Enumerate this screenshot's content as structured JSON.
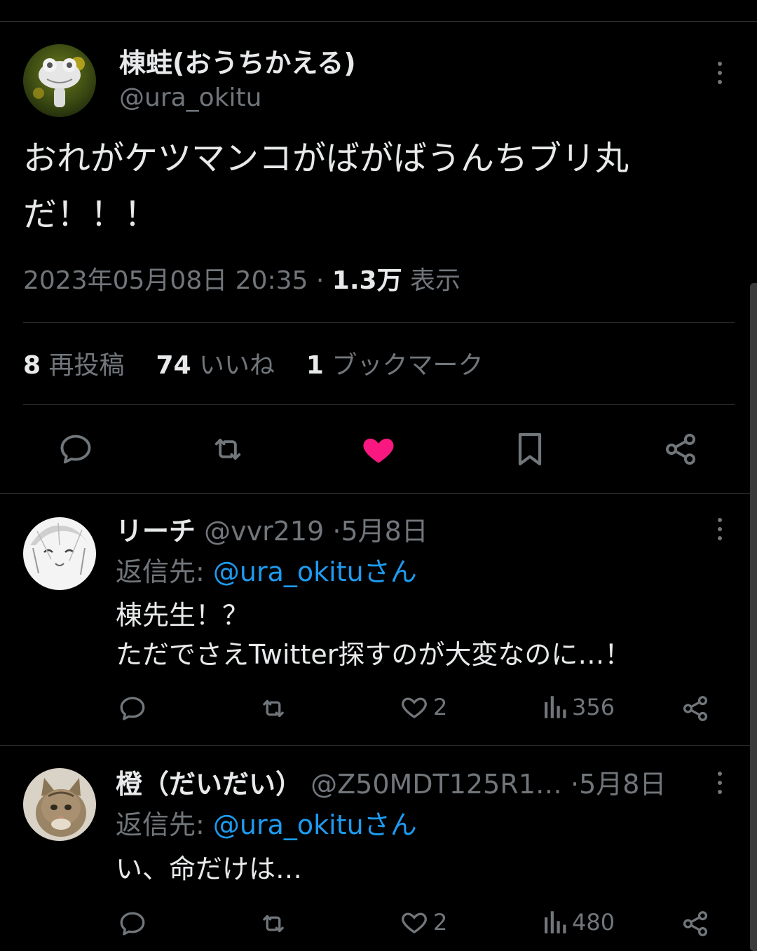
{
  "main_tweet": {
    "display_name": "棟蛙(おうちかえる)",
    "handle": "@ura_okitu",
    "text_line1": "おれがケツマンコがばがばうんちブリ丸",
    "text_line2": "だ！！！",
    "timestamp": "2023年05月08日 20:35",
    "dot": "·",
    "views_count": "1.3万",
    "views_label": "表示",
    "reposts_count": "8",
    "reposts_label": "再投稿",
    "likes_count": "74",
    "likes_label": "いいね",
    "bookmarks_count": "1",
    "bookmarks_label": "ブックマーク",
    "liked": true
  },
  "replies": [
    {
      "display_name": "リーチ",
      "handle": "@vvr219",
      "dot": "·",
      "date": "5月8日",
      "reply_to_label": "返信先:",
      "reply_to_handle": "@ura_okitu",
      "reply_to_suffix": "さん",
      "text_line1": "棟先生！？",
      "text_line2": "ただでさえTwitter探すのが大変なのに…！",
      "likes": "2",
      "views": "356"
    },
    {
      "display_name": "橙（だいだい）",
      "handle": "@Z50MDT125R1…",
      "dot": "·",
      "date": "5月8日",
      "reply_to_label": "返信先:",
      "reply_to_handle": "@ura_okitu",
      "reply_to_suffix": "さん",
      "text_line1": "い、命だけは…",
      "likes": "2",
      "views": "480"
    }
  ],
  "colors": {
    "background": "#000000",
    "text": "#e7e9ea",
    "secondary": "#71767b",
    "link": "#1d9bf0",
    "like": "#f91880",
    "divider": "#2f3336"
  }
}
